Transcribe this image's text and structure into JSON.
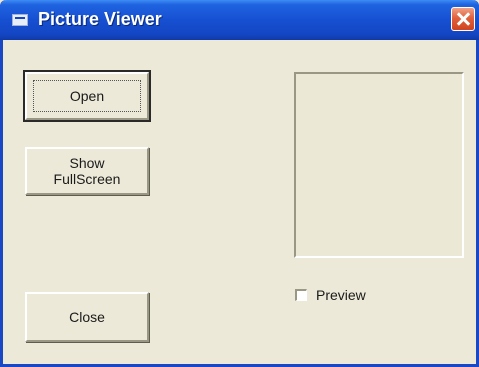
{
  "window": {
    "title": "Picture Viewer"
  },
  "buttons": {
    "open_label": "Open",
    "fullscreen_label": "Show FullScreen",
    "close_label": "Close"
  },
  "preview": {
    "checkbox_label": "Preview",
    "checked": false
  },
  "icons": {
    "app": "window-app-icon",
    "close": "close-x-icon"
  },
  "colors": {
    "titlebar": "#1650d2",
    "close_button": "#e1603c",
    "face": "#ece9d8"
  }
}
